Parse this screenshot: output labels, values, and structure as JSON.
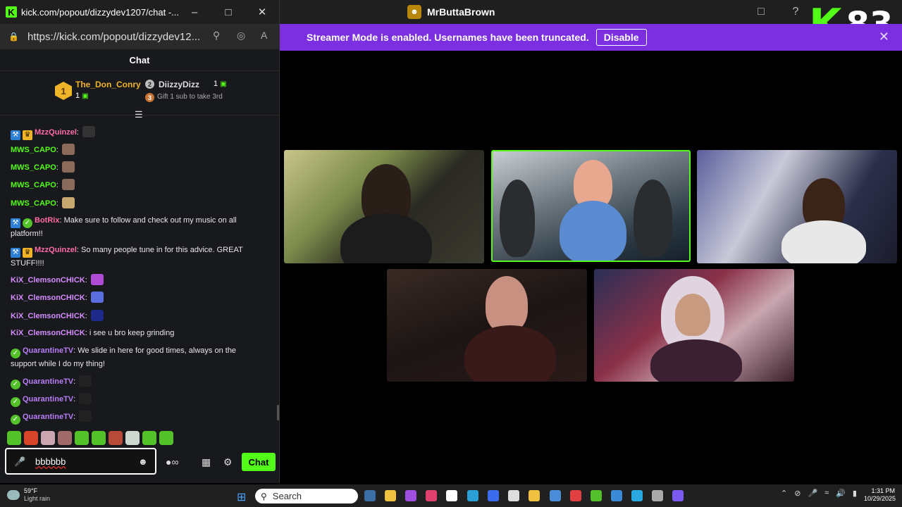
{
  "popout": {
    "title": "kick.com/popout/dizzydev1207/chat -...",
    "url": "https://kick.com/popout/dizzydev12...",
    "chat_header": "Chat",
    "leaderboard": {
      "first": {
        "rank": "1",
        "name": "The_Don_Conry",
        "count": "1"
      },
      "second": {
        "rank": "2",
        "name": "DiizzyDizz",
        "count": "1"
      },
      "third": {
        "rank": "3",
        "text": "Gift 1 sub to take 3rd"
      }
    },
    "messages": [
      {
        "user": "MzzQuinzel",
        "user_color": "#ff6aa8",
        "badges": [
          "mod",
          "vip"
        ],
        "text": "",
        "emote": "#333"
      },
      {
        "user": "MWS_CAPO",
        "user_color": "#53fc18",
        "badges": [],
        "text": "",
        "emote": "#8a6a5a"
      },
      {
        "user": "MWS_CAPO",
        "user_color": "#53fc18",
        "badges": [],
        "text": "",
        "emote": "#8a6a5a"
      },
      {
        "user": "MWS_CAPO",
        "user_color": "#53fc18",
        "badges": [],
        "text": "",
        "emote": "#8a6a5a"
      },
      {
        "user": "MWS_CAPO",
        "user_color": "#53fc18",
        "badges": [],
        "text": "",
        "emote": "#c9a870"
      },
      {
        "user": "BotRix",
        "user_color": "#ff6aa8",
        "badges": [
          "mod",
          "verified"
        ],
        "text": "Make sure to follow and check out my music on all platform!!",
        "emote": ""
      },
      {
        "user": "MzzQuinzel",
        "user_color": "#ff6aa8",
        "badges": [
          "mod",
          "vip"
        ],
        "text": "So many people tune in for this advice. GREAT STUFF!!!!",
        "emote": ""
      },
      {
        "user": "KiX_ClemsonCHICK",
        "user_color": "#d58cff",
        "badges": [],
        "text": "",
        "emote": "#b04bd6"
      },
      {
        "user": "KiX_ClemsonCHICK",
        "user_color": "#d58cff",
        "badges": [],
        "text": "",
        "emote": "#5b6ee0"
      },
      {
        "user": "KiX_ClemsonCHICK",
        "user_color": "#d58cff",
        "badges": [],
        "text": "",
        "emote": "#1e2a8a"
      },
      {
        "user": "KiX_ClemsonCHICK",
        "user_color": "#d58cff",
        "badges": [],
        "text": "i see u bro keep grinding",
        "emote": ""
      },
      {
        "user": "QuarantineTV",
        "user_color": "#b67df6",
        "badges": [
          "verified"
        ],
        "text": "We slide in here for good times, always on the support while I do my thing!",
        "emote": ""
      },
      {
        "user": "QuarantineTV",
        "user_color": "#b67df6",
        "badges": [
          "verified"
        ],
        "text": "",
        "emote": "#222"
      },
      {
        "user": "QuarantineTV",
        "user_color": "#b67df6",
        "badges": [
          "verified"
        ],
        "text": "",
        "emote": "#222"
      },
      {
        "user": "QuarantineTV",
        "user_color": "#b67df6",
        "badges": [
          "verified"
        ],
        "text": "",
        "emote": "#222"
      }
    ],
    "emote_strip": [
      "#53c22a",
      "#d8442a",
      "#c9a6b0",
      "#a06a6a",
      "#53c22a",
      "#53c22a",
      "#b84a3a",
      "#cfd8d0",
      "#53c22a",
      "#53c22a"
    ],
    "input": {
      "value": "bbbbbb"
    },
    "send_label": "Chat"
  },
  "main": {
    "title": "MrButtaBrown",
    "counter": "83",
    "banner": {
      "text": "Streamer Mode is enabled. Usernames have been truncated.",
      "button": "Disable"
    }
  },
  "taskbar": {
    "weather_temp": "59°F",
    "weather_cond": "Light rain",
    "search": "Search",
    "time": "1:31 PM",
    "date": "10/29/2025",
    "apps": [
      "#3a6ea5",
      "#f0c040",
      "#a050e0",
      "#e04070",
      "#ffffff",
      "#2a9fd6",
      "#3b6cf0",
      "#dddddd",
      "#f0c040",
      "#4a8cd8",
      "#e04040",
      "#53c22a",
      "#3a8ad6",
      "#2aa8e0",
      "#aaaaaa",
      "#7a5af0"
    ]
  },
  "colors": {
    "kick_green": "#53fc18",
    "banner_purple": "#7b2fe0",
    "chat_bg": "#18191c"
  }
}
